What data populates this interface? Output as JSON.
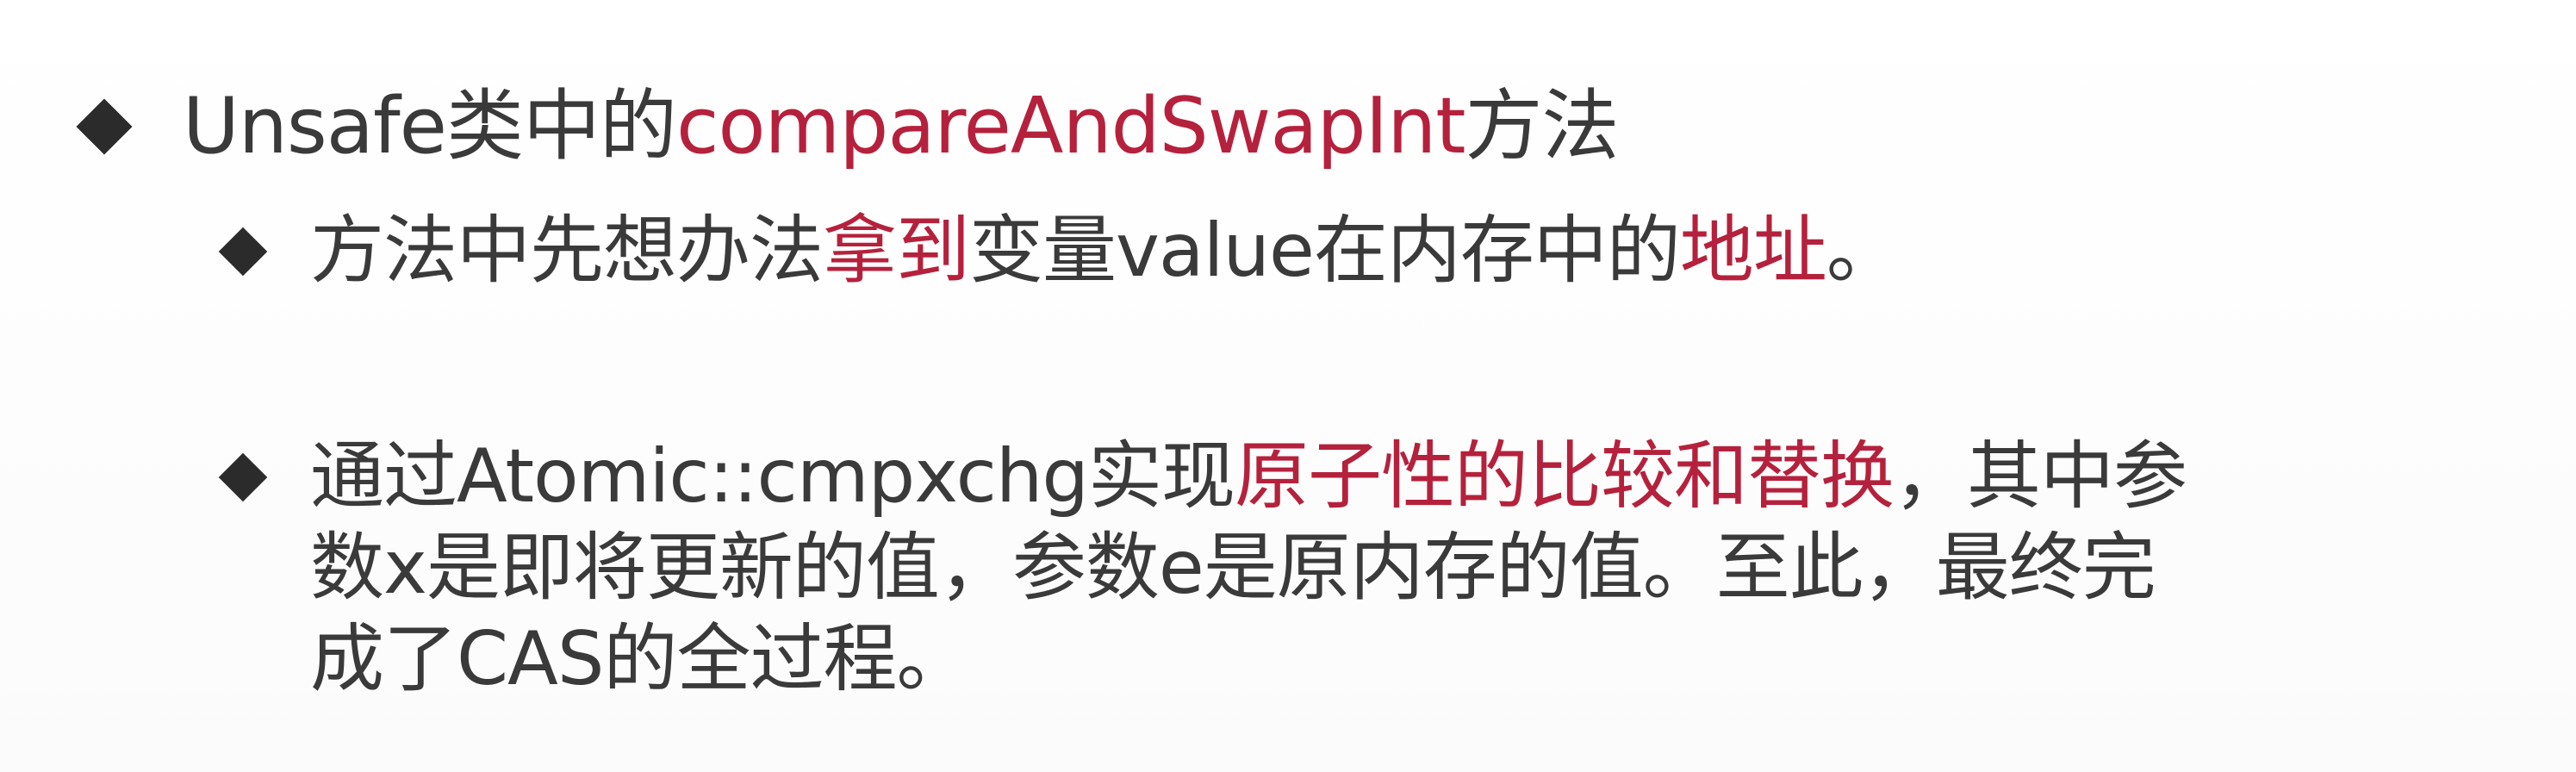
{
  "bullets": [
    {
      "level": 1,
      "parts": [
        {
          "text": "Unsafe类中的",
          "highlight": false
        },
        {
          "text": "compareAndSwapInt",
          "highlight": true
        },
        {
          "text": "方法",
          "highlight": false
        }
      ]
    },
    {
      "level": 2,
      "parts": [
        {
          "text": "方法中先想办法",
          "highlight": false
        },
        {
          "text": "拿到",
          "highlight": true
        },
        {
          "text": "变量value在内存中的",
          "highlight": false
        },
        {
          "text": "地址",
          "highlight": true
        },
        {
          "text": "。",
          "highlight": false
        }
      ]
    },
    {
      "level": 2,
      "lines": [
        [
          {
            "text": "通过Atomic::cmpxchg实现",
            "highlight": false
          },
          {
            "text": "原子性的比较和替换",
            "highlight": true
          },
          {
            "text": "，其中参",
            "highlight": false
          }
        ],
        [
          {
            "text": "数x是即将更新的值，参数e是原内存的值。至此，最终完",
            "highlight": false
          }
        ],
        [
          {
            "text": "成了CAS的全过程。",
            "highlight": false
          }
        ]
      ]
    }
  ],
  "colors": {
    "text": "#3a3a3a",
    "highlight": "#b5213c",
    "bullet": "#2b2b2b"
  }
}
